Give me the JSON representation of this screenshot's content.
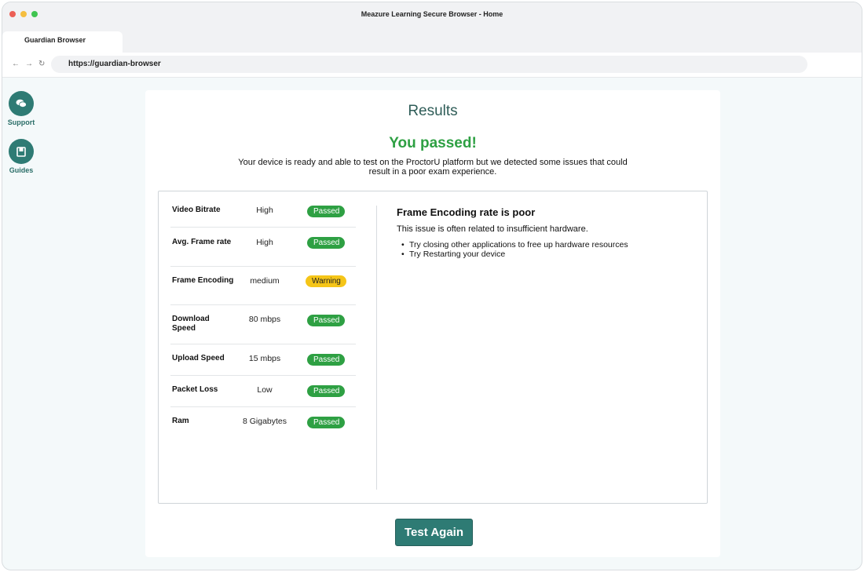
{
  "window": {
    "title": "Meazure Learning Secure Browser - Home"
  },
  "tab": {
    "label": "Guardian Browser"
  },
  "navbar": {
    "url": "https://guardian-browser",
    "back_icon": "←",
    "forward_icon": "→",
    "reload_icon": "↻"
  },
  "sidebar": {
    "items": [
      {
        "label": "Support",
        "icon": "chat-bubbles-icon"
      },
      {
        "label": "Guides",
        "icon": "book-icon"
      }
    ]
  },
  "results": {
    "title": "Results",
    "status_title": "You passed!",
    "description": "Your device is ready and able to test on the ProctorU platform but we detected some issues that could result in a poor exam experience.",
    "metrics": [
      {
        "label": "Video Bitrate",
        "value": "High",
        "status": "Passed"
      },
      {
        "label": "Avg. Frame rate",
        "value": "High",
        "status": "Passed"
      },
      {
        "label": "Frame Encoding",
        "value": "medium",
        "status": "Warning"
      },
      {
        "label": "Download Speed",
        "value": "80 mbps",
        "status": "Passed"
      },
      {
        "label": "Upload Speed",
        "value": "15 mbps",
        "status": "Passed"
      },
      {
        "label": "Packet Loss",
        "value": "Low",
        "status": "Passed"
      },
      {
        "label": "Ram",
        "value": "8 Gigabytes",
        "status": "Passed"
      }
    ],
    "detail": {
      "title": "Frame Encoding rate is poor",
      "description": "This issue is often related to insufficient hardware.",
      "tips": [
        "Try closing other applications to free up hardware resources",
        "Try Restarting your device"
      ]
    },
    "test_again_label": "Test Again"
  },
  "colors": {
    "accent": "#2e7b74",
    "passed": "#2ea043",
    "warning": "#f5c518"
  }
}
